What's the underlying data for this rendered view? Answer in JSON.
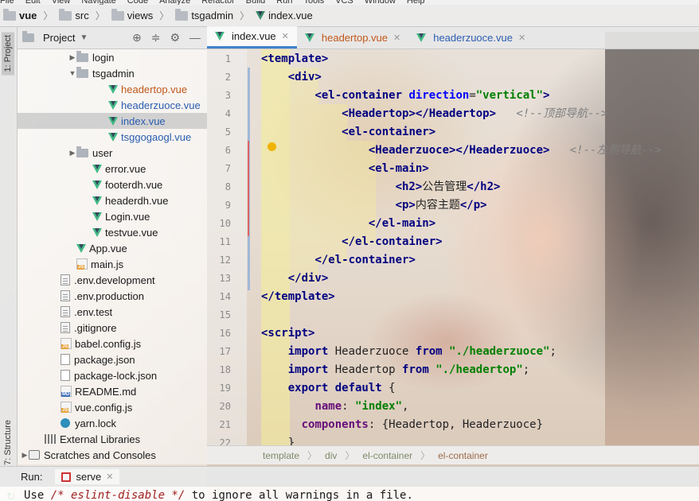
{
  "menu": [
    "File",
    "Edit",
    "View",
    "Navigate",
    "Code",
    "Analyze",
    "Refactor",
    "Build",
    "Run",
    "Tools",
    "VCS",
    "Window",
    "Help"
  ],
  "breadcrumb": {
    "project": "vue",
    "items": [
      "src",
      "views",
      "tsgadmin"
    ],
    "file": "index.vue"
  },
  "toolstrip": {
    "project_tab": "1: Project",
    "structure_tab": "7: Structure"
  },
  "project_panel": {
    "title": "Project",
    "tree": [
      {
        "label": "login",
        "type": "folder",
        "depth": 3,
        "arrow": "▶"
      },
      {
        "label": "tsgadmin",
        "type": "folder",
        "depth": 3,
        "arrow": "▼"
      },
      {
        "label": "headertop.vue",
        "type": "vue",
        "depth": 5,
        "color": "orange"
      },
      {
        "label": "headerzuoce.vue",
        "type": "vue",
        "depth": 5,
        "color": "blue"
      },
      {
        "label": "index.vue",
        "type": "vue",
        "depth": 5,
        "color": "blue",
        "selected": true
      },
      {
        "label": "tsggogaogl.vue",
        "type": "vue",
        "depth": 5,
        "color": "blue"
      },
      {
        "label": "user",
        "type": "folder",
        "depth": 3,
        "arrow": "▶"
      },
      {
        "label": "error.vue",
        "type": "vue",
        "depth": 4
      },
      {
        "label": "footerdh.vue",
        "type": "vue",
        "depth": 4
      },
      {
        "label": "headerdh.vue",
        "type": "vue",
        "depth": 4
      },
      {
        "label": "Login.vue",
        "type": "vue",
        "depth": 4
      },
      {
        "label": "testvue.vue",
        "type": "vue",
        "depth": 4
      },
      {
        "label": "App.vue",
        "type": "vue",
        "depth": 3
      },
      {
        "label": "main.js",
        "type": "js",
        "depth": 3
      },
      {
        "label": ".env.development",
        "type": "file",
        "depth": 2
      },
      {
        "label": ".env.production",
        "type": "file",
        "depth": 2
      },
      {
        "label": ".env.test",
        "type": "file",
        "depth": 2
      },
      {
        "label": ".gitignore",
        "type": "file",
        "depth": 2
      },
      {
        "label": "babel.config.js",
        "type": "js",
        "depth": 2
      },
      {
        "label": "package.json",
        "type": "json",
        "depth": 2
      },
      {
        "label": "package-lock.json",
        "type": "json",
        "depth": 2
      },
      {
        "label": "README.md",
        "type": "md",
        "depth": 2
      },
      {
        "label": "vue.config.js",
        "type": "js",
        "depth": 2
      },
      {
        "label": "yarn.lock",
        "type": "yarn",
        "depth": 2
      },
      {
        "label": "External Libraries",
        "type": "lib",
        "depth": 1
      },
      {
        "label": "Scratches and Consoles",
        "type": "scratch",
        "depth": 0,
        "arrow": "▶"
      }
    ]
  },
  "tabs": [
    {
      "label": "index.vue",
      "active": true
    },
    {
      "label": "headertop.vue",
      "active": false,
      "color": "orange"
    },
    {
      "label": "headerzuoce.vue",
      "active": false,
      "color": "blue"
    }
  ],
  "editor": {
    "line_numbers": [
      "1",
      "2",
      "3",
      "4",
      "5",
      "6",
      "7",
      "8",
      "9",
      "10",
      "11",
      "12",
      "13",
      "14",
      "15",
      "16",
      "17",
      "18",
      "19",
      "20",
      "21",
      "22"
    ],
    "lines": [
      [
        {
          "t": "<template>",
          "c": "tag"
        }
      ],
      [
        {
          "t": "    "
        },
        {
          "t": "<div>",
          "c": "tag"
        }
      ],
      [
        {
          "t": "        "
        },
        {
          "t": "<el-container ",
          "c": "tag"
        },
        {
          "t": "direction",
          "c": "attr"
        },
        {
          "t": "=",
          "c": "plain"
        },
        {
          "t": "\"vertical\"",
          "c": "str"
        },
        {
          "t": ">",
          "c": "tag"
        }
      ],
      [
        {
          "t": "            "
        },
        {
          "t": "<Headertop></Headertop>",
          "c": "tag"
        },
        {
          "t": "   "
        },
        {
          "t": "<!--顶部导航-->",
          "c": "cm"
        }
      ],
      [
        {
          "t": "            "
        },
        {
          "t": "<el-container>",
          "c": "tag"
        }
      ],
      [
        {
          "t": "                "
        },
        {
          "t": "<Headerzuoce></Headerzuoce>",
          "c": "tag"
        },
        {
          "t": "   "
        },
        {
          "t": "<!--左侧导航-->",
          "c": "cm"
        }
      ],
      [
        {
          "t": "                "
        },
        {
          "t": "<el-main>",
          "c": "tag"
        }
      ],
      [
        {
          "t": "                    "
        },
        {
          "t": "<h2>",
          "c": "tag"
        },
        {
          "t": "公告管理",
          "c": "plain"
        },
        {
          "t": "</h2>",
          "c": "tag"
        }
      ],
      [
        {
          "t": "                    "
        },
        {
          "t": "<p>",
          "c": "tag"
        },
        {
          "t": "内容主题",
          "c": "plain"
        },
        {
          "t": "</p>",
          "c": "tag"
        }
      ],
      [
        {
          "t": "                "
        },
        {
          "t": "</el-main>",
          "c": "tag"
        }
      ],
      [
        {
          "t": "            "
        },
        {
          "t": "</el-container>",
          "c": "tag"
        }
      ],
      [
        {
          "t": "        "
        },
        {
          "t": "</el-container>",
          "c": "tag"
        }
      ],
      [
        {
          "t": "    "
        },
        {
          "t": "</div>",
          "c": "tag"
        }
      ],
      [
        {
          "t": "</template>",
          "c": "tag"
        }
      ],
      [],
      [
        {
          "t": "<script>",
          "c": "tag"
        }
      ],
      [
        {
          "t": "    "
        },
        {
          "t": "import ",
          "c": "kw"
        },
        {
          "t": "Headerzuoce ",
          "c": "plain"
        },
        {
          "t": "from ",
          "c": "kw"
        },
        {
          "t": "\"./headerzuoce\"",
          "c": "str"
        },
        {
          "t": ";",
          "c": "plain"
        }
      ],
      [
        {
          "t": "    "
        },
        {
          "t": "import ",
          "c": "kw"
        },
        {
          "t": "Headertop ",
          "c": "plain"
        },
        {
          "t": "from ",
          "c": "kw"
        },
        {
          "t": "\"./headertop\"",
          "c": "str"
        },
        {
          "t": ";",
          "c": "plain"
        }
      ],
      [
        {
          "t": "    "
        },
        {
          "t": "export default ",
          "c": "kw"
        },
        {
          "t": "{",
          "c": "plain"
        }
      ],
      [
        {
          "t": "        "
        },
        {
          "t": "name",
          "c": "prop"
        },
        {
          "t": ": ",
          "c": "plain"
        },
        {
          "t": "\"index\"",
          "c": "str"
        },
        {
          "t": ",",
          "c": "plain"
        }
      ],
      [
        {
          "t": "      "
        },
        {
          "t": "components",
          "c": "prop"
        },
        {
          "t": ": {Headertop, Headerzuoce}",
          "c": "plain"
        }
      ],
      [
        {
          "t": "    "
        },
        {
          "t": "}",
          "c": "plain"
        }
      ]
    ]
  },
  "editor_breadcrumb": [
    "template",
    "div",
    "el-container",
    "el-container"
  ],
  "run": {
    "label": "Run:",
    "config": "serve"
  },
  "console": {
    "prefix": "Use ",
    "comment": "/* eslint-disable */",
    "suffix": " to ignore all warnings in a file."
  },
  "colors": {
    "tag": "#000080",
    "attr": "#0000ff",
    "string": "#008000",
    "comment": "#808080",
    "accent": "#4083c9"
  }
}
